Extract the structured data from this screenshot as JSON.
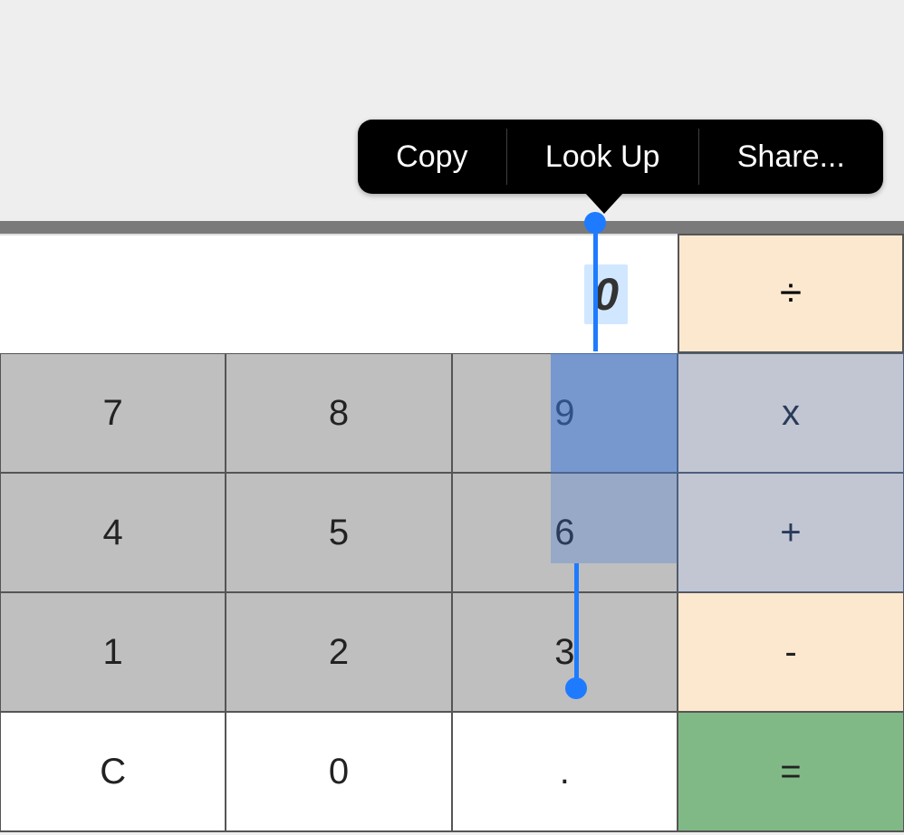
{
  "popover": {
    "copy": "Copy",
    "lookup": "Look Up",
    "share": "Share..."
  },
  "display": {
    "value": "0"
  },
  "ops": {
    "divide": "÷",
    "multiply": "x",
    "add": "+",
    "subtract": "-",
    "equals": "="
  },
  "keys": {
    "seven": "7",
    "eight": "8",
    "nine": "9",
    "four": "4",
    "five": "5",
    "six": "6",
    "one": "1",
    "two": "2",
    "three": "3",
    "clear": "C",
    "zero": "0",
    "dot": "."
  }
}
